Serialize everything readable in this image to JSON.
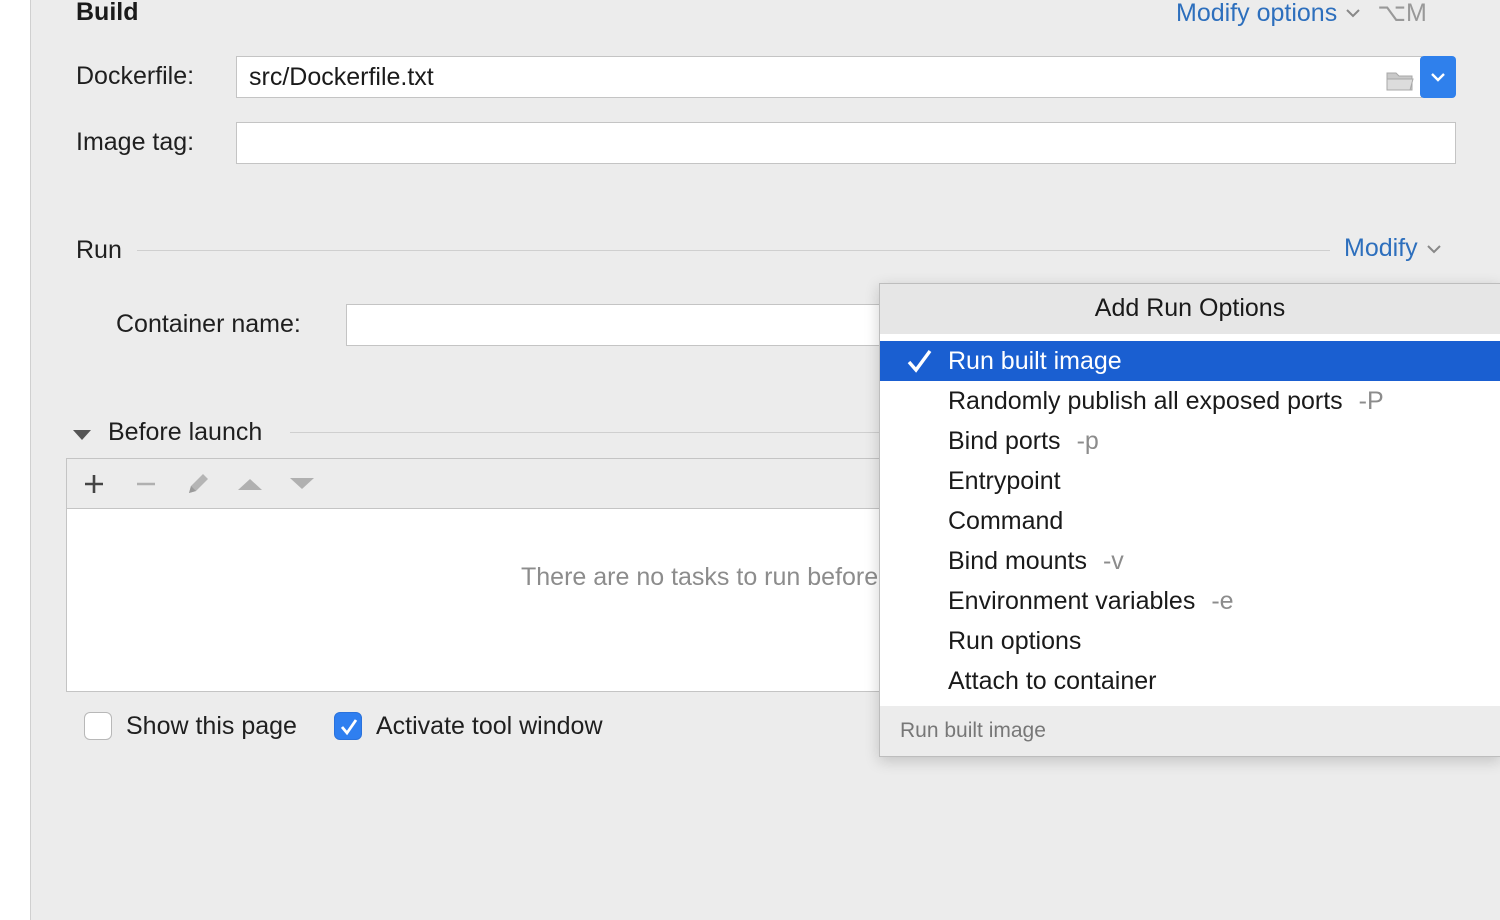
{
  "build": {
    "title": "Build",
    "modify_options_label": "Modify options",
    "modify_options_shortcut": "⌥M",
    "dockerfile_label": "Dockerfile:",
    "dockerfile_value": "src/Dockerfile.txt",
    "image_tag_label": "Image tag:",
    "image_tag_value": ""
  },
  "run": {
    "title": "Run",
    "modify_label": "Modify",
    "container_name_label": "Container name:",
    "container_name_value": ""
  },
  "before_launch": {
    "title": "Before launch",
    "empty_text": "There are no tasks to run before launch"
  },
  "footer": {
    "show_this_page_label": "Show this page",
    "show_this_page_checked": false,
    "activate_tool_window_label": "Activate tool window",
    "activate_tool_window_checked": true
  },
  "popup": {
    "title": "Add Run Options",
    "items": [
      {
        "label": "Run built image",
        "hint": "",
        "selected": true,
        "checked": true
      },
      {
        "label": "Randomly publish all exposed ports",
        "hint": "-P"
      },
      {
        "label": "Bind ports",
        "hint": "-p"
      },
      {
        "label": "Entrypoint",
        "hint": ""
      },
      {
        "label": "Command",
        "hint": ""
      },
      {
        "label": "Bind mounts",
        "hint": "-v"
      },
      {
        "label": "Environment variables",
        "hint": "-e"
      },
      {
        "label": "Run options",
        "hint": ""
      },
      {
        "label": "Attach to container",
        "hint": ""
      }
    ],
    "footer_text": "Run built image"
  },
  "colors": {
    "link": "#2d6fbd",
    "selection": "#1a5fd1",
    "checkbox_checked": "#2f7ff0"
  }
}
